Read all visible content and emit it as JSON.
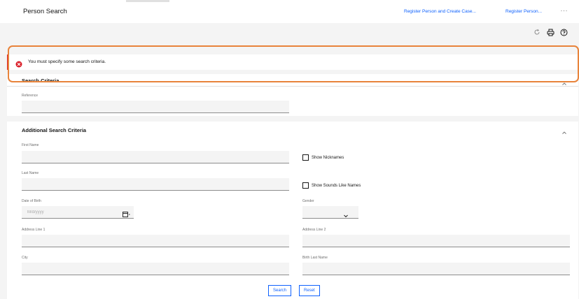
{
  "header": {
    "title": "Person Search",
    "actions": [
      "Register Person and Create Case...",
      "Register Person..."
    ],
    "more_icon": "more-icon"
  },
  "toolbar": {
    "icons": [
      "refresh-icon",
      "print-icon",
      "help-icon"
    ]
  },
  "error": {
    "message": "You must specify some search criteria.",
    "color": "#da1e28"
  },
  "highlight_color": "#e8833a",
  "search_criteria": {
    "title": "Search Criteria",
    "reference_label": "Reference",
    "reference_value": ""
  },
  "additional": {
    "title": "Additional Search Criteria",
    "first_name_label": "First Name",
    "show_nicknames_label": "Show Nicknames",
    "last_name_label": "Last Name",
    "show_sounds_like_label": "Show Sounds Like Names",
    "dob_label": "Date of Birth",
    "dob_placeholder": "M/d/yyyy",
    "gender_label": "Gender",
    "gender_value": "",
    "address1_label": "Address Line 1",
    "address2_label": "Address Line 2",
    "city_label": "City",
    "birth_last_name_label": "Birth Last Name"
  },
  "buttons": {
    "search": "Search",
    "reset": "Reset"
  },
  "accent_color": "#0f62fe"
}
